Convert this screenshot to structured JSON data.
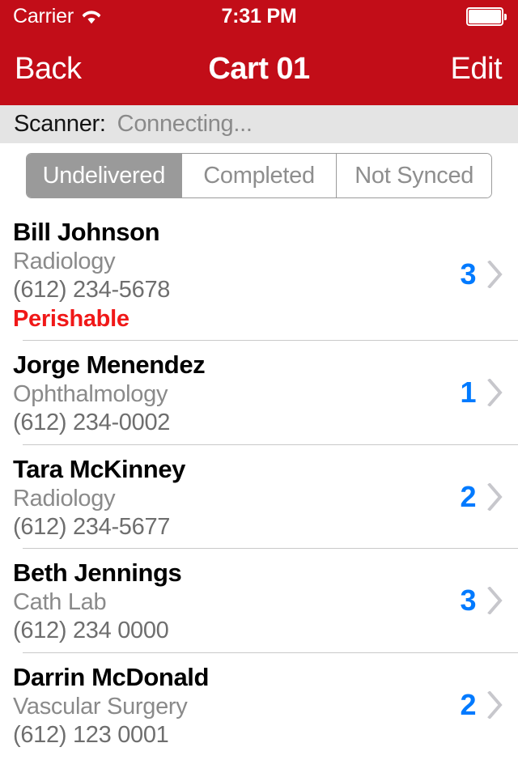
{
  "status_bar": {
    "carrier": "Carrier",
    "wifi_icon": "wifi-icon",
    "time": "7:31 PM",
    "battery_icon": "battery-full-icon"
  },
  "nav_bar": {
    "back_label": "Back",
    "title": "Cart 01",
    "edit_label": "Edit",
    "background_color": "#C20D18"
  },
  "scanner_bar": {
    "label": "Scanner:",
    "status": "Connecting...",
    "background_color": "#E4E4E4"
  },
  "segmented_control": {
    "selected_index": 0,
    "segments": [
      {
        "label": "Undelivered",
        "selected": true
      },
      {
        "label": "Completed",
        "selected": false
      },
      {
        "label": "Not Synced",
        "selected": false
      }
    ],
    "selected_background": "#9A9A9A",
    "unselected_text_color": "#8E8E8E"
  },
  "list": {
    "count_color": "#007AFF",
    "flag_color": "#F01818",
    "rows": [
      {
        "name": "Bill Johnson",
        "department": "Radiology",
        "phone": "(612) 234-5678",
        "flag": "Perishable",
        "count": "3",
        "chevron_icon": "chevron-right-icon"
      },
      {
        "name": "Jorge Menendez",
        "department": "Ophthalmology",
        "phone": "(612) 234-0002",
        "flag": "",
        "count": "1",
        "chevron_icon": "chevron-right-icon"
      },
      {
        "name": "Tara McKinney",
        "department": "Radiology",
        "phone": "(612) 234-5677",
        "flag": "",
        "count": "2",
        "chevron_icon": "chevron-right-icon"
      },
      {
        "name": "Beth Jennings",
        "department": "Cath Lab",
        "phone": "(612) 234 0000",
        "flag": "",
        "count": "3",
        "chevron_icon": "chevron-right-icon"
      },
      {
        "name": "Darrin McDonald",
        "department": "Vascular Surgery",
        "phone": "(612) 123 0001",
        "flag": "",
        "count": "2",
        "chevron_icon": "chevron-right-icon"
      }
    ]
  }
}
